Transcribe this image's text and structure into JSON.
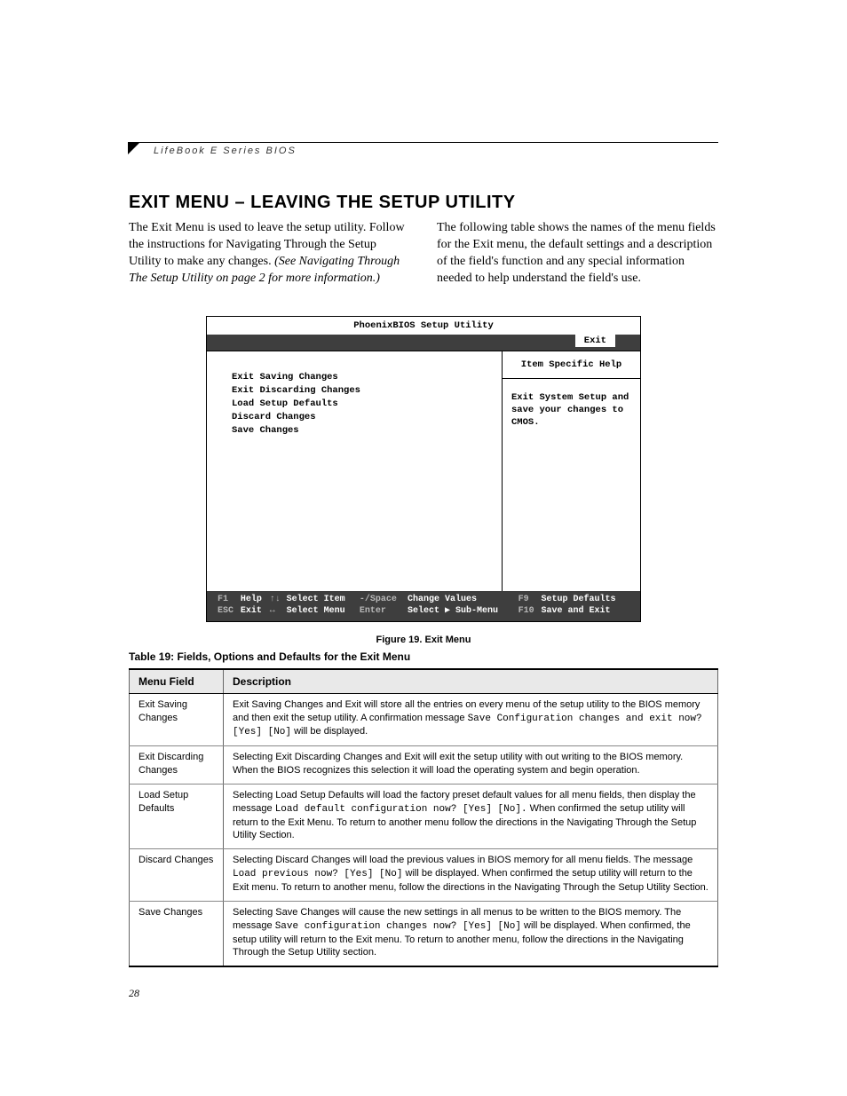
{
  "header": {
    "running": "LifeBook E Series BIOS"
  },
  "title": "EXIT MENU – LEAVING THE SETUP UTILITY",
  "intro": {
    "left_a": "The Exit Menu is used to leave the setup utility. Follow the instructions for Navigating Through the Setup Utility to make any changes. ",
    "left_b": "(See Navigating Through The Setup Utility on page 2 for more information.)",
    "right": "The following table shows the names of the menu fields for the Exit menu, the default settings and a description of the field's function and any special information needed to help understand the field's use."
  },
  "bios": {
    "title": "PhoenixBIOS Setup Utility",
    "tab": "Exit",
    "items": [
      "Exit Saving Changes",
      "Exit Discarding Changes",
      "Load Setup Defaults",
      "Discard Changes",
      "Save Changes"
    ],
    "help_title": "Item Specific Help",
    "help_text": "Exit System Setup and save your changes to CMOS.",
    "foot": {
      "r1": {
        "k1": "F1",
        "l1": "Help",
        "k2": "↑↓",
        "l2": "Select Item",
        "k3": "-/Space",
        "l3": "Change Values",
        "k4": "F9",
        "l4": "Setup Defaults"
      },
      "r2": {
        "k1": "ESC",
        "l1": "Exit",
        "k2": "↔",
        "l2": "Select Menu",
        "k3": "Enter",
        "l3": "Select ▶ Sub-Menu",
        "k4": "F10",
        "l4": "Save and Exit"
      }
    }
  },
  "figure_caption": "Figure 19.  Exit Menu",
  "table_caption": "Table 19: Fields, Options and Defaults for the Exit Menu",
  "thead": {
    "c1": "Menu Field",
    "c2": "Description"
  },
  "rows": [
    {
      "field": "Exit Saving Changes",
      "d1": "Exit Saving Changes and Exit will store all the entries on every menu of the setup utility to the BIOS memory and then exit the setup utility. A confirmation message ",
      "code": "Save Configuration changes and exit now? [Yes] [No]",
      "d2": " will be displayed."
    },
    {
      "field": "Exit Discarding Changes",
      "d1": "Selecting Exit Discarding Changes and Exit will exit the setup utility with out writing to the BIOS memory. When the BIOS recognizes this selection it will load the operating system and begin operation.",
      "code": "",
      "d2": ""
    },
    {
      "field": "Load Setup Defaults",
      "d1": "Selecting Load Setup Defaults will load the factory preset default values for all menu fields, then display the message ",
      "code": "Load default configuration now? [Yes] [No].",
      "d2": " When confirmed the setup utility will return to the Exit Menu. To return to another menu follow the directions in the Navigating Through the Setup Utility Section."
    },
    {
      "field": "Discard Changes",
      "d1": "Selecting Discard Changes will load the previous values in BIOS memory for all menu fields. The message ",
      "code": "Load pre­vious now? [Yes] [No]",
      "d2": " will be displayed. When confirmed the setup utility will return to the Exit menu. To return to another menu, follow the directions in the Navigating Through the Setup Utility Section."
    },
    {
      "field": "Save Changes",
      "d1": "Selecting Save Changes will cause the new settings in all menus to be written to the BIOS memory. The message ",
      "code": "Save configuration changes now? [Yes] [No]",
      "d2": " will be displayed. When confirmed, the setup utility will return to the Exit menu. To return to another menu, follow the directions in the Navigating Through the Setup Utility section."
    }
  ],
  "page_number": "28"
}
